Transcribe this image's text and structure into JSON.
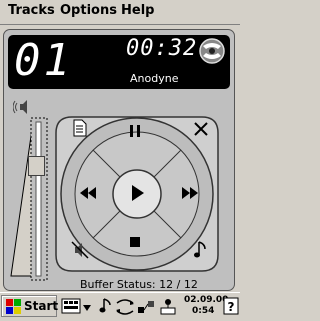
{
  "menu": {
    "tracks": "Tracks",
    "options": "Options",
    "help": "Help"
  },
  "display": {
    "track_number": "01",
    "elapsed_time": "00:32",
    "song_title": "Anodyne"
  },
  "volume": {
    "level": 0.75
  },
  "controls": {
    "playlist": "playlist-icon",
    "close": "close-icon",
    "pause": "pause-icon",
    "previous": "previous-icon",
    "play": "play-icon",
    "next": "next-icon",
    "mute": "mute-icon",
    "stop": "stop-icon",
    "music": "music-note-icon"
  },
  "buffer_status": "Buffer Status: 12 / 12",
  "taskbar": {
    "start_label": "Start",
    "date": "02.09.00",
    "time": "0:54"
  },
  "colors": {
    "lcd_background": "#000000",
    "lcd_text": "#ffffff",
    "panel": "#bfbfbf"
  }
}
